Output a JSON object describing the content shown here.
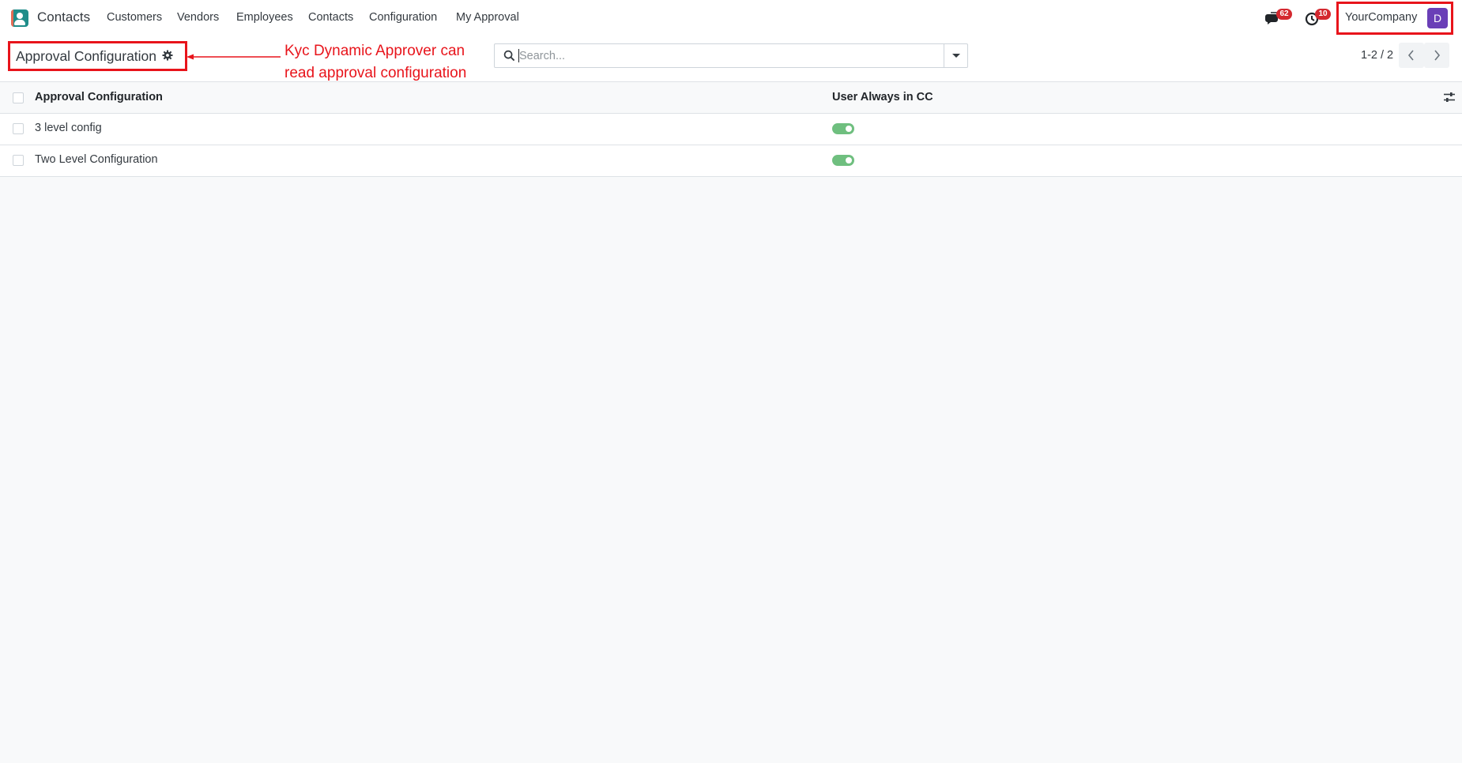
{
  "navbar": {
    "app_name": "Contacts",
    "menu": [
      "Customers",
      "Vendors",
      "Employees",
      "Contacts",
      "Configuration",
      "My Approval"
    ],
    "messages_badge": "62",
    "activities_badge": "10",
    "company": "YourCompany",
    "avatar_initial": "D"
  },
  "control_panel": {
    "breadcrumb_title": "Approval Configuration",
    "search_placeholder": "Search...",
    "pager": "1-2 / 2"
  },
  "annotation": {
    "text_line1": "Kyc Dynamic Approver can",
    "text_line2": "read approval configuration",
    "color": "#e8141b"
  },
  "list": {
    "columns": [
      "Approval Configuration",
      "User Always in CC"
    ],
    "rows": [
      {
        "name": "3 level config",
        "user_always_in_cc": true
      },
      {
        "name": "Two Level Configuration",
        "user_always_in_cc": true
      }
    ]
  },
  "colors": {
    "brand": "#1f8d8a",
    "badge": "#d4282f",
    "avatar": "#6a3fb7",
    "toggle_on": "#6fbf7f"
  }
}
